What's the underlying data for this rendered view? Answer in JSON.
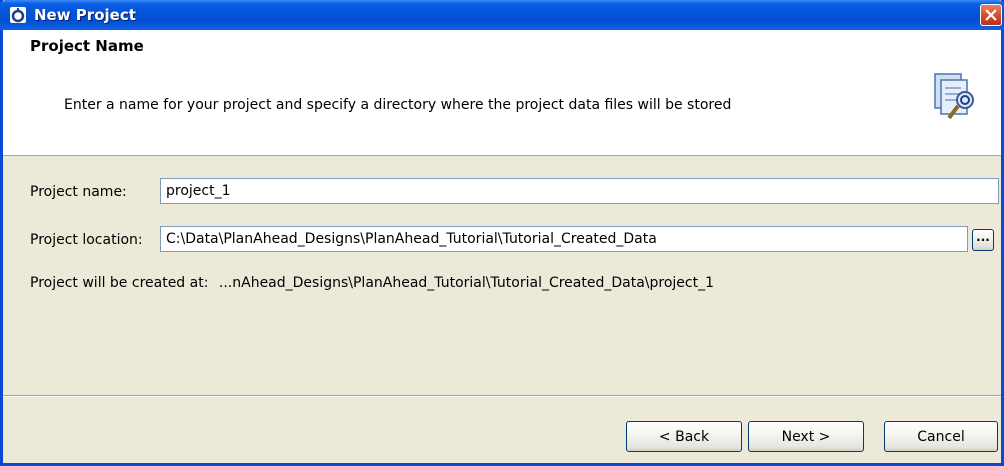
{
  "window": {
    "title": "New Project"
  },
  "header": {
    "title": "Project Name",
    "description": "Enter a name for your project and specify a directory where the project data files will be stored"
  },
  "form": {
    "name_label": "Project name:",
    "name_value": "project_1",
    "location_label": "Project location:",
    "location_value": "C:\\Data\\PlanAhead_Designs\\PlanAhead_Tutorial\\Tutorial_Created_Data",
    "browse_label": "...",
    "created_at_label": "Project will be created at:",
    "created_at_value": "...nAhead_Designs\\PlanAhead_Tutorial\\Tutorial_Created_Data\\project_1"
  },
  "buttons": {
    "back": "< Back",
    "next": "Next >",
    "cancel": "Cancel"
  },
  "colors": {
    "titlebar": "#0654d9",
    "dialog_bg": "#ece9d8",
    "close_button": "#d34a2b"
  }
}
